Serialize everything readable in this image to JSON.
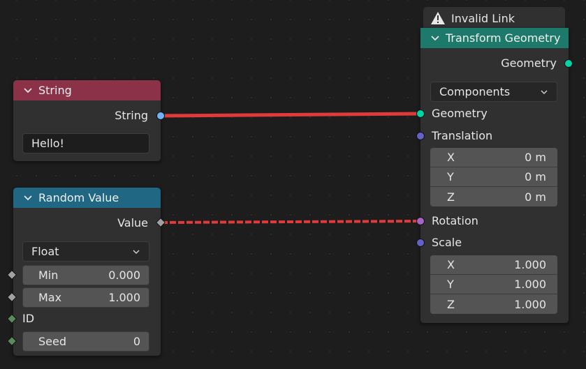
{
  "colors": {
    "string_header": "#8b3148",
    "random_header": "#1f6783",
    "transform_header": "#1d7a6a",
    "link_red": "#e03a3a",
    "socket_geometry": "#00d6a3",
    "socket_vector": "#6363c7",
    "socket_string": "#70b2ff",
    "socket_float": "#a1a1a1",
    "socket_rotation": "#a663c7",
    "socket_int": "#598c5c"
  },
  "invalid_link": {
    "icon": "warning-icon",
    "label": "Invalid Link"
  },
  "string_node": {
    "title": "String",
    "output_label": "String",
    "value": "Hello!"
  },
  "random_node": {
    "title": "Random Value",
    "output_label": "Value",
    "type_option": "Float",
    "min_label": "Min",
    "min_value": "0.000",
    "max_label": "Max",
    "max_value": "1.000",
    "id_label": "ID",
    "seed_label": "Seed",
    "seed_value": "0"
  },
  "transform_node": {
    "title": "Transform Geometry",
    "output_label": "Geometry",
    "mode_option": "Components",
    "geometry_label": "Geometry",
    "translation_label": "Translation",
    "translation": [
      {
        "axis": "X",
        "value": "0 m"
      },
      {
        "axis": "Y",
        "value": "0 m"
      },
      {
        "axis": "Z",
        "value": "0 m"
      }
    ],
    "rotation_label": "Rotation",
    "scale_label": "Scale",
    "scale": [
      {
        "axis": "X",
        "value": "1.000"
      },
      {
        "axis": "Y",
        "value": "1.000"
      },
      {
        "axis": "Z",
        "value": "1.000"
      }
    ]
  }
}
